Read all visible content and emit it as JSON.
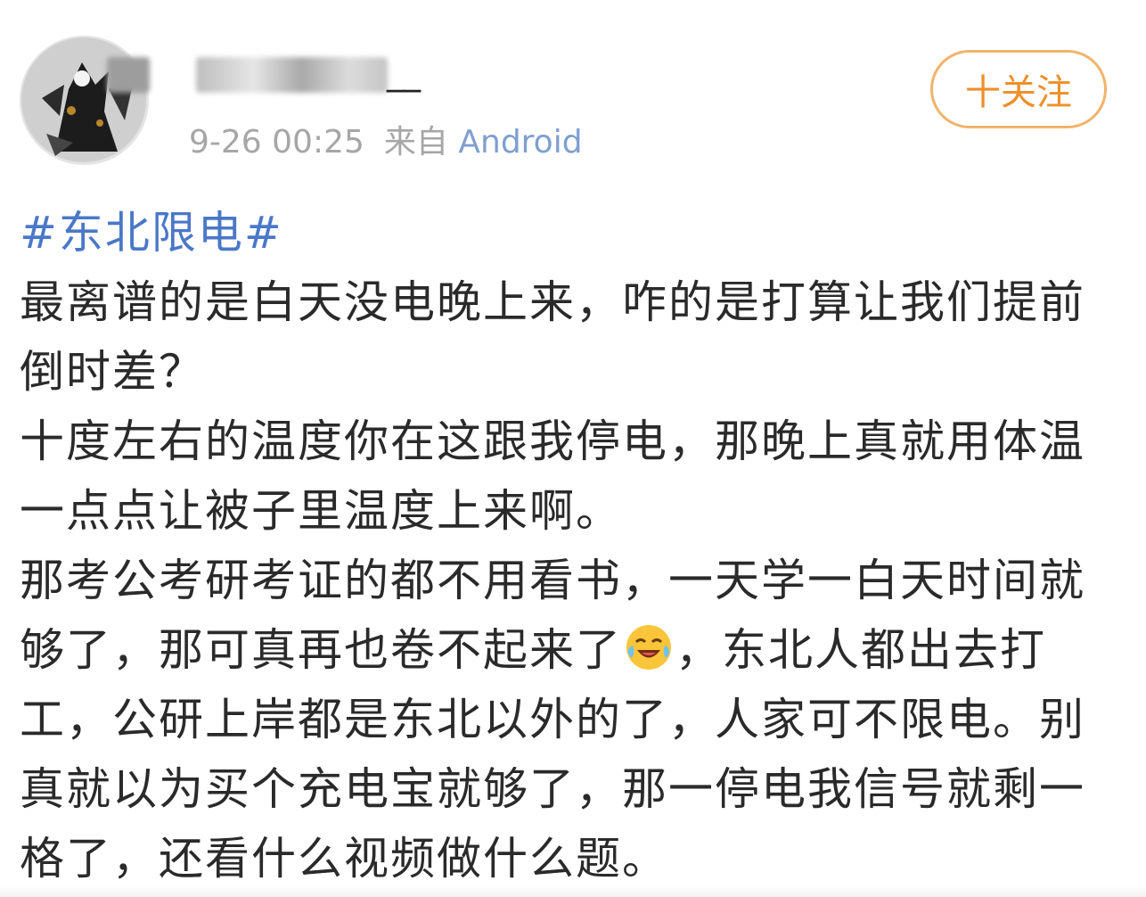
{
  "post": {
    "timestamp": "9-26 00:25",
    "source_prefix": "来自",
    "source": "Android",
    "username_visible_suffix": "__",
    "follow_label": "十关注",
    "hashtag": "#东北限电#",
    "paragraphs": [
      "最离谱的是白天没电晚上来，咋的是打算让我们提前倒时差？",
      "十度左右的温度你在这跟我停电，那晚上真就用体温一点点让被子里温度上来啊。"
    ],
    "para3_before_emoji": "那考公考研考证的都不用看书，一天学一白天时间就够了，那可真再也卷不起来了",
    "emoji_name": "crying-laughing-emoji",
    "para3_after_emoji": "，东北人都出去打工，公研上岸都是东北以外的了，人家可不限电。别真就以为买个充电宝就够了，那一停电我信号就剩一格了，还看什么视频做什么题。"
  },
  "colors": {
    "hashtag": "#4a78c8",
    "source": "#7f9fd0",
    "follow_border": "#f1b36b",
    "follow_text": "#ee8f2b",
    "body_text": "#2a2a2a",
    "meta_text": "#a6a6a6"
  }
}
